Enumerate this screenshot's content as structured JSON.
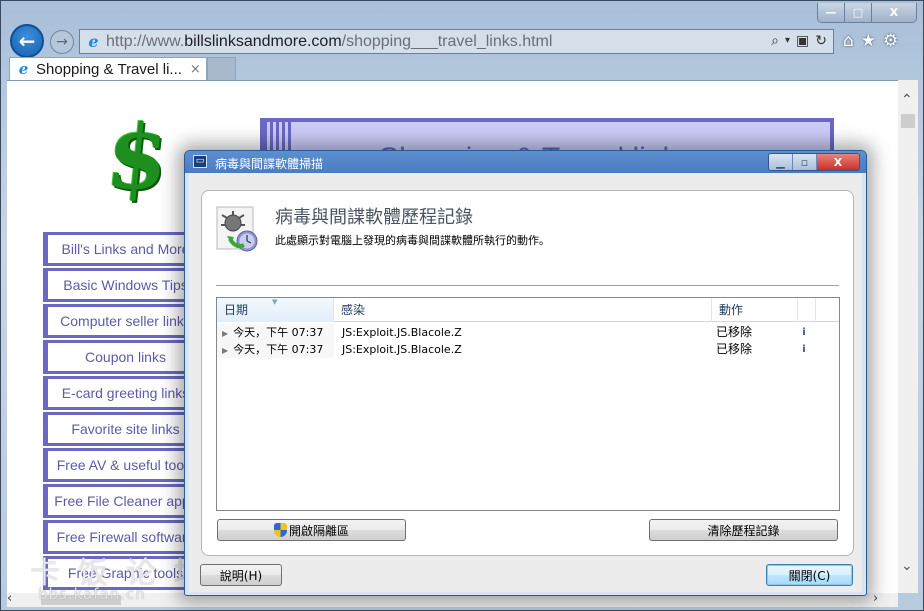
{
  "browser": {
    "url_prefix": "http://www.",
    "url_domain": "billslinksandmore.com",
    "url_path": "/shopping___travel_links.html",
    "tab_label": "Shopping & Travel li...",
    "tab_close": "×",
    "window_controls": {
      "minimize": "—",
      "maximize": "□",
      "close": "X"
    },
    "nav": {
      "back": "←",
      "forward": "→"
    },
    "address_icons": {
      "search": "⌕",
      "dropdown": "▾",
      "compat": "▣",
      "refresh": "↻"
    },
    "toolbar_icons": {
      "home": "⌂",
      "favorites": "★",
      "tools": "⚙"
    }
  },
  "page": {
    "logo_glyph": "$",
    "banner_title": "Shopping & Travel links",
    "links": [
      "Bill's Links and More",
      "Basic Windows Tips",
      "Computer seller links",
      "Coupon links",
      "E-card greeting links",
      "Favorite site links",
      "Free AV & useful tools",
      "Free File Cleaner apps",
      "Free Firewall software",
      "Free Graphic tools"
    ],
    "watermark": "卡饭论坛",
    "watermark_url": "bbs.kafan.cn"
  },
  "dialog": {
    "title": "病毒與間諜軟體掃描",
    "controls": {
      "minimize": "▁",
      "maximize": "▫",
      "close": "X"
    },
    "header_title": "病毒與間諜軟體歷程記錄",
    "header_desc": "此處顯示對電腦上發現的病毒與間諜軟體所執行的動作。",
    "columns": {
      "date": "日期",
      "threat": "感染",
      "action": "動作"
    },
    "sort_indicator": "▼",
    "rows": [
      {
        "date": "今天，下午 07:37",
        "threat": "JS:Exploit.JS.Blacole.Z",
        "action": "已移除",
        "info": "i"
      },
      {
        "date": "今天，下午 07:37",
        "threat": "JS:Exploit.JS.Blacole.Z",
        "action": "已移除",
        "info": "i"
      }
    ],
    "buttons": {
      "open_quarantine": "開啟隔離區",
      "clear_history": "清除歷程記錄",
      "help": "說明(H)",
      "close": "關閉(C)"
    }
  }
}
